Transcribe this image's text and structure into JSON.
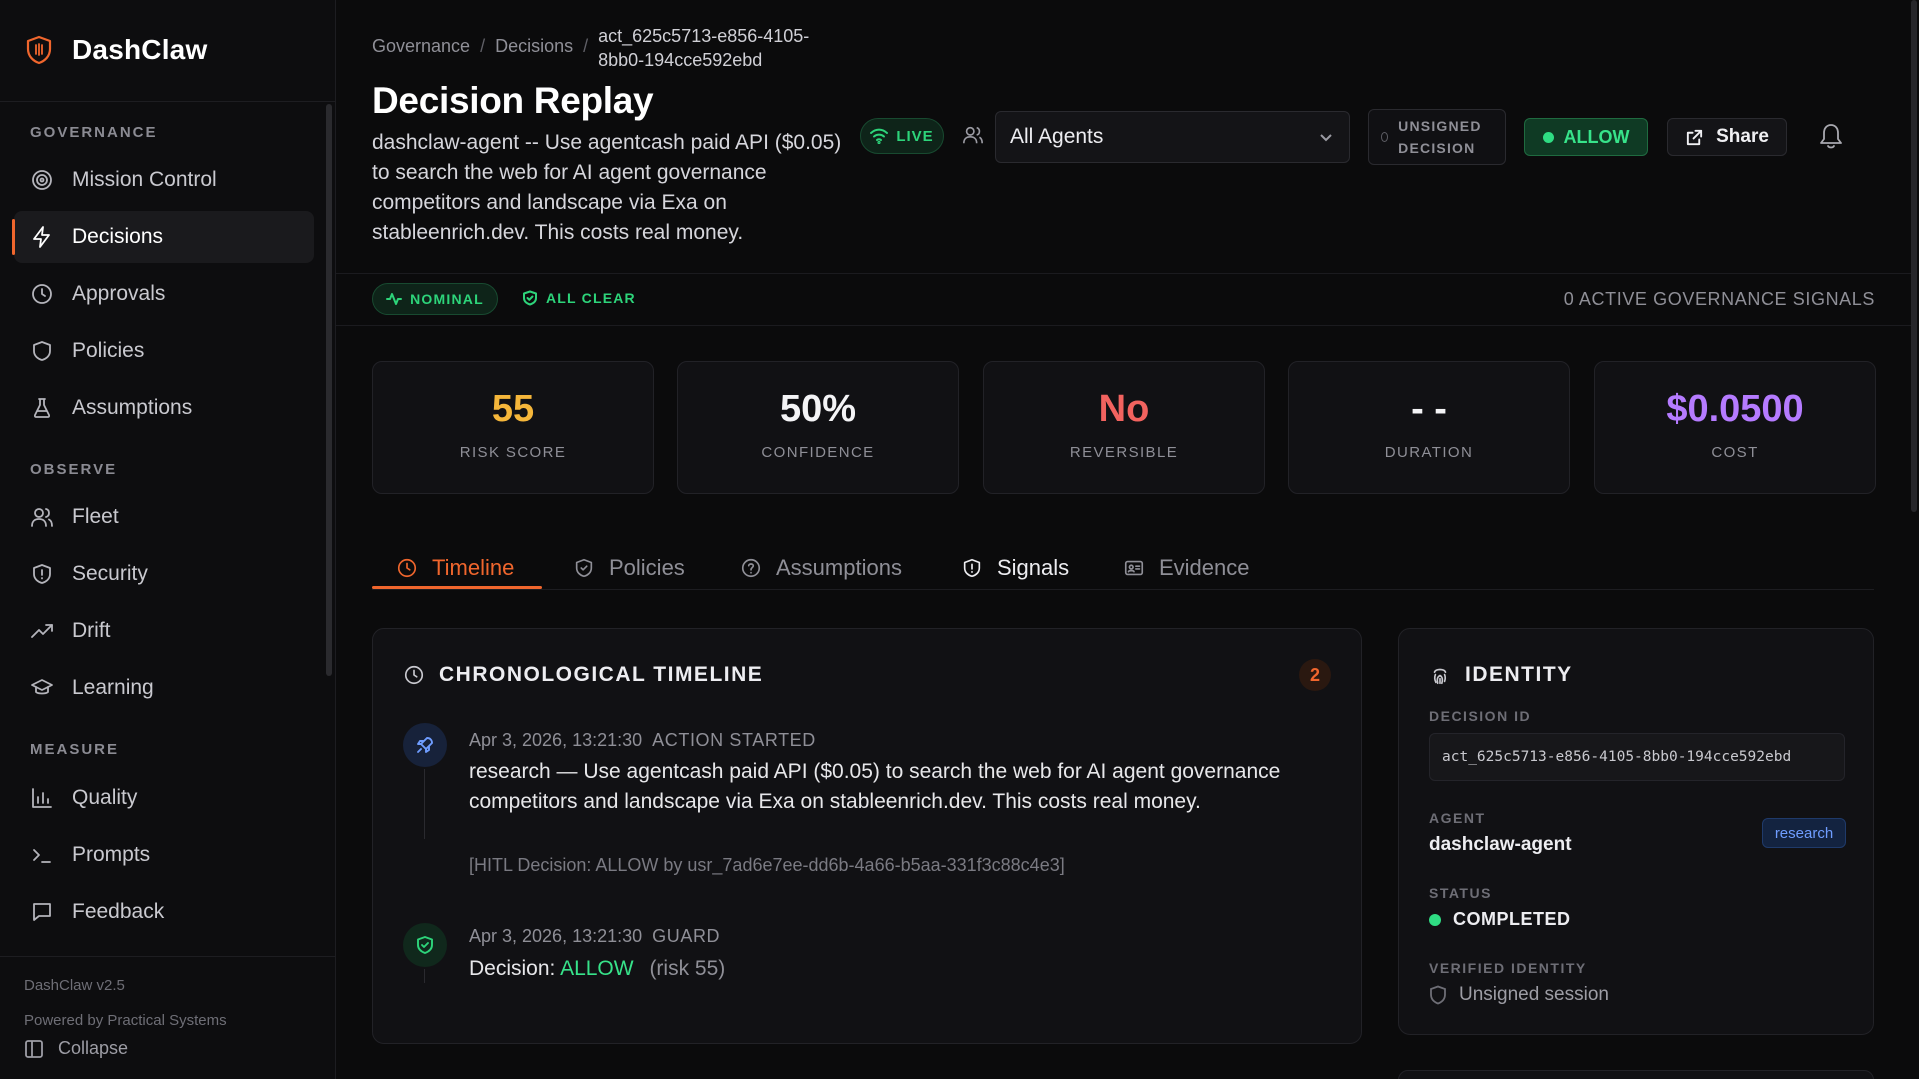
{
  "app": {
    "name": "DashClaw"
  },
  "sidebar": {
    "sections": [
      {
        "title": "GOVERNANCE",
        "items": [
          {
            "label": "Mission Control",
            "icon": "target-icon"
          },
          {
            "label": "Decisions",
            "icon": "bolt-icon",
            "active": true
          },
          {
            "label": "Approvals",
            "icon": "clock-icon"
          },
          {
            "label": "Policies",
            "icon": "shield-icon"
          },
          {
            "label": "Assumptions",
            "icon": "flask-icon"
          }
        ]
      },
      {
        "title": "OBSERVE",
        "items": [
          {
            "label": "Fleet",
            "icon": "users-icon"
          },
          {
            "label": "Security",
            "icon": "shield-alert-icon"
          },
          {
            "label": "Drift",
            "icon": "trending-up-icon"
          },
          {
            "label": "Learning",
            "icon": "graduation-cap-icon"
          }
        ]
      },
      {
        "title": "MEASURE",
        "items": [
          {
            "label": "Quality",
            "icon": "bar-chart-icon"
          },
          {
            "label": "Prompts",
            "icon": "terminal-icon"
          },
          {
            "label": "Feedback",
            "icon": "message-square-icon"
          }
        ]
      }
    ],
    "version": "DashClaw v2.5",
    "powered_by": "Powered by Practical Systems",
    "collapse_label": "Collapse"
  },
  "header": {
    "breadcrumb": [
      "Governance",
      "Decisions",
      "act_625c5713-e856-4105-8bb0-194cce592ebd"
    ],
    "title": "Decision Replay",
    "description": "dashclaw-agent -- Use agentcash paid API ($0.05) to search the web for AI agent governance competitors and landscape via Exa on stableenrich.dev. This costs real money.",
    "live_label": "LIVE",
    "agent_filter": "All Agents",
    "unsigned_label": "UNSIGNED DECISION",
    "verdict_label": "ALLOW",
    "share_label": "Share"
  },
  "status_strip": {
    "nominal_label": "NOMINAL",
    "all_clear_label": "ALL CLEAR",
    "signals_text": "0 ACTIVE GOVERNANCE SIGNALS"
  },
  "metrics": [
    {
      "value": "55",
      "label": "RISK SCORE",
      "color": "#f5b63a"
    },
    {
      "value": "50%",
      "label": "CONFIDENCE",
      "color": "#f4f4f6"
    },
    {
      "value": "No",
      "label": "REVERSIBLE",
      "color": "#f2635f"
    },
    {
      "value": "- -",
      "label": "DURATION",
      "color": "#f4f4f6"
    },
    {
      "value": "$0.0500",
      "label": "COST",
      "color": "#b57bff"
    }
  ],
  "tabs": [
    {
      "label": "Timeline",
      "icon": "clock-icon",
      "active": true
    },
    {
      "label": "Policies",
      "icon": "shield-icon"
    },
    {
      "label": "Assumptions",
      "icon": "help-circle-icon"
    },
    {
      "label": "Signals",
      "icon": "shield-alert-icon"
    },
    {
      "label": "Evidence",
      "icon": "id-card-icon"
    }
  ],
  "timeline": {
    "title": "CHRONOLOGICAL TIMELINE",
    "count": "2",
    "events": [
      {
        "timestamp": "Apr 3, 2026, 13:21:30",
        "kind": "ACTION STARTED",
        "body": "research — Use agentcash paid API ($0.05) to search the web for AI agent governance competitors and landscape via Exa on stableenrich.dev. This costs real money.",
        "note": "[HITL Decision: ALLOW by usr_7ad6e7ee-dd6b-4a66-b5aa-331f3c88c4e3]"
      },
      {
        "timestamp": "Apr 3, 2026, 13:21:30",
        "kind": "GUARD",
        "decision_prefix": "Decision:",
        "decision_value": "ALLOW",
        "risk": "(risk 55)"
      }
    ]
  },
  "identity": {
    "title": "IDENTITY",
    "decision_id_label": "DECISION ID",
    "decision_id": "act_625c5713-e856-4105-8bb0-194cce592ebd",
    "agent_label": "AGENT",
    "agent_name": "dashclaw-agent",
    "agent_tag": "research",
    "status_label": "STATUS",
    "status_value": "COMPLETED",
    "verified_label": "VERIFIED IDENTITY",
    "verified_value": "Unsigned session"
  }
}
